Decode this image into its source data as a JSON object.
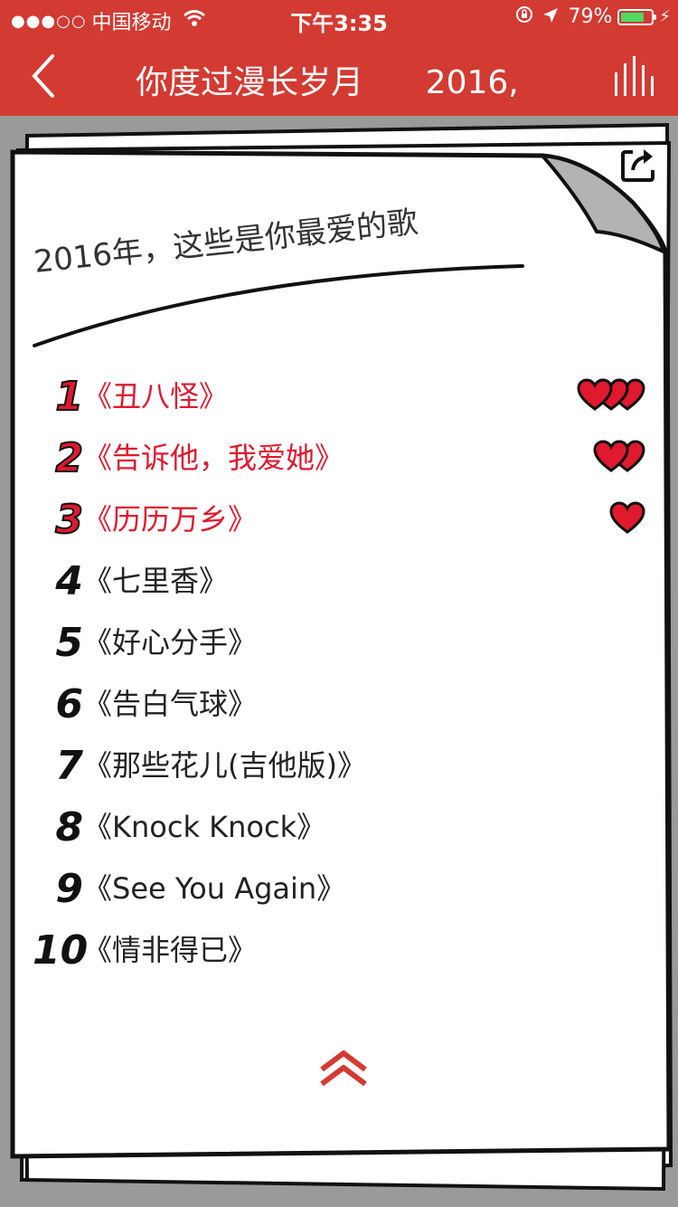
{
  "status_bar": {
    "signal_dots": "●●●○○",
    "carrier": "中国移动",
    "time": "下午3:35",
    "battery_percent": "79%",
    "battery_level": 0.79
  },
  "nav": {
    "title": "你度过漫长岁月      2016,"
  },
  "card": {
    "title": "2016年，这些是你最爱的歌"
  },
  "colors": {
    "brand_red": "#d33a32",
    "highlight_red": "#e0192e",
    "background_gray": "#9a9a9a"
  },
  "songs": [
    {
      "rank": "1",
      "title": "《丑八怪》",
      "hearts": 3,
      "highlight": true
    },
    {
      "rank": "2",
      "title": "《告诉他，我爱她》",
      "hearts": 2,
      "highlight": true
    },
    {
      "rank": "3",
      "title": "《历历万乡》",
      "hearts": 1,
      "highlight": true
    },
    {
      "rank": "4",
      "title": "《七里香》",
      "hearts": 0,
      "highlight": false
    },
    {
      "rank": "5",
      "title": "《好心分手》",
      "hearts": 0,
      "highlight": false
    },
    {
      "rank": "6",
      "title": "《告白气球》",
      "hearts": 0,
      "highlight": false
    },
    {
      "rank": "7",
      "title": "《那些花儿(吉他版)》",
      "hearts": 0,
      "highlight": false
    },
    {
      "rank": "8",
      "title": "《Knock Knock》",
      "hearts": 0,
      "highlight": false
    },
    {
      "rank": "9",
      "title": "《See You Again》",
      "hearts": 0,
      "highlight": false
    },
    {
      "rank": "10",
      "title": "《情非得已》",
      "hearts": 0,
      "highlight": false
    }
  ],
  "icons": {
    "back": "chevron-left-icon",
    "menu": "bars-icon",
    "share": "share-icon",
    "scroll_up": "double-chevron-up-icon",
    "heart": "heart-icon"
  }
}
